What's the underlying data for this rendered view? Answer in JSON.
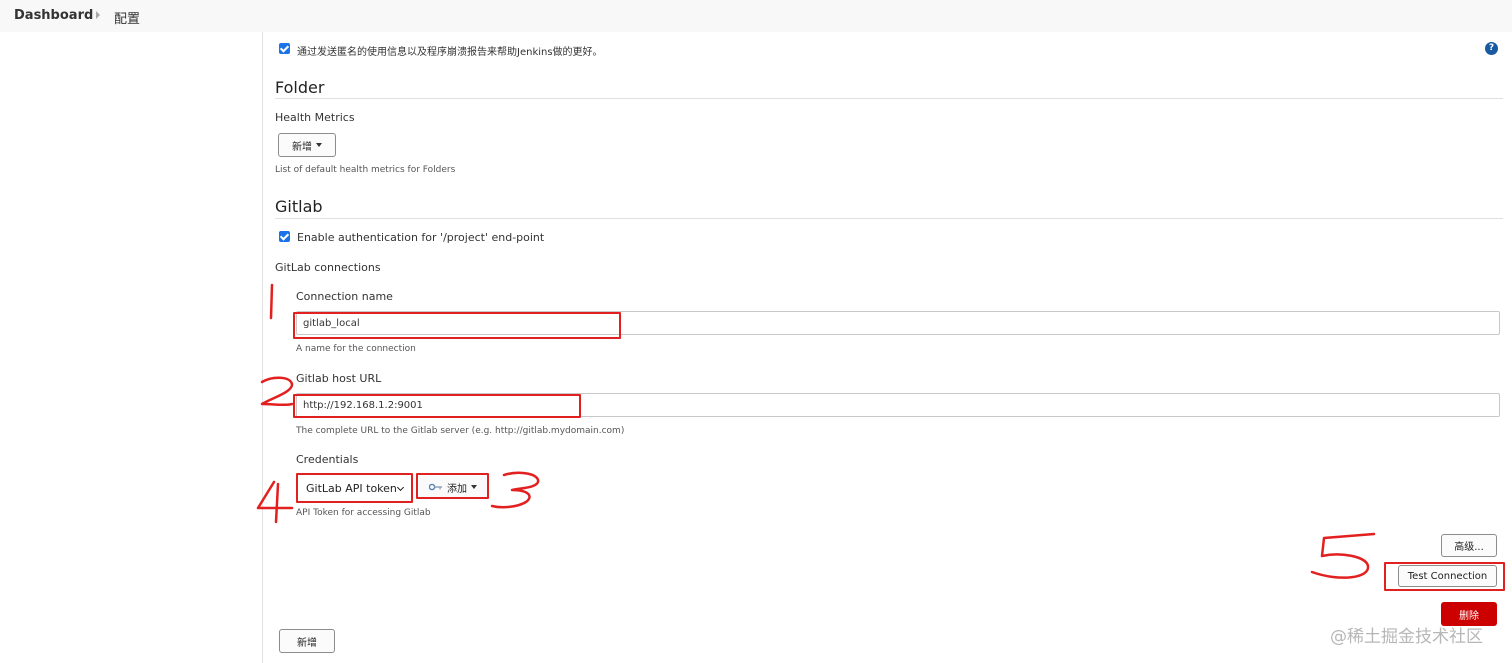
{
  "breadcrumb": {
    "home": "Dashboard",
    "current": "配置"
  },
  "usage_stats": {
    "label": "通过发送匿名的使用信息以及程序崩溃报告来帮助Jenkins做的更好。",
    "checked": true,
    "help_icon": "?"
  },
  "folder": {
    "heading": "Folder",
    "health_metrics_label": "Health Metrics",
    "add_button": "新增",
    "hint": "List of default health metrics for Folders"
  },
  "gitlab": {
    "heading": "Gitlab",
    "auth_checkbox_label": "Enable authentication for '/project' end-point",
    "auth_checked": true,
    "connections_label": "GitLab connections",
    "connection_name_label": "Connection name",
    "connection_name_value": "gitlab_local",
    "connection_name_hint": "A name for the connection",
    "host_url_label": "Gitlab host URL",
    "host_url_value": "http://192.168.1.2:9001",
    "host_url_hint": "The complete URL to the Gitlab server (e.g. http://gitlab.mydomain.com)",
    "credentials_label": "Credentials",
    "credentials_selected": "GitLab API token",
    "add_credentials_button": "添加",
    "credentials_hint": "API Token for accessing Gitlab",
    "advanced_button": "高级...",
    "test_connection_button": "Test Connection",
    "delete_button": "删除",
    "add_connection_button": "新增"
  },
  "watermark": "@稀土掘金技术社区",
  "colors": {
    "accent_red": "#cc0000",
    "checkbox_blue": "#1a73e8",
    "annotation_red": "#e32020"
  },
  "icons": {
    "key_icon": "key-icon",
    "help_icon": "help-icon"
  }
}
